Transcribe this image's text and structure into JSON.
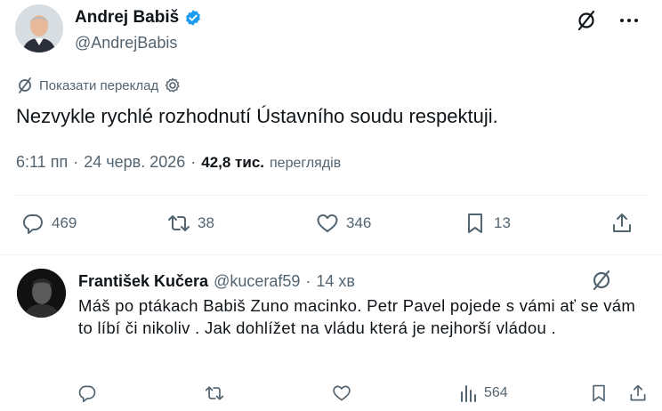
{
  "post": {
    "author_name": "Andrej Babiš",
    "author_handle": "@AndrejBabis",
    "translate_label": "Показати переклад",
    "text": "Nezvykle rychlé rozhodnutí Ústavního soudu respektuji.",
    "time": "6:11 пп",
    "date": "24 черв. 2026",
    "sep": "·",
    "views_count": "42,8 тис.",
    "views_label": "переглядів",
    "stats": {
      "replies": "469",
      "reposts": "38",
      "likes": "346",
      "bookmarks": "13"
    }
  },
  "reply": {
    "author_name": "František Kučera",
    "author_handle": "@kuceraf59",
    "sep": "·",
    "time": "14 хв",
    "text": "Máš po ptákach Babiš Zuno macinko. Petr Pavel pojede s vámi ať se vám to líbí či nikoliv . Jak dohlížet na vládu která je nejhorší vládou .",
    "views": "564"
  },
  "colors": {
    "text": "#0f1419",
    "secondary": "#536471",
    "verified": "#1d9bf0",
    "divider": "#eff3f4"
  },
  "icons": [
    "verified-badge-icon",
    "no-translate-icon",
    "more-icon",
    "gear-icon",
    "reply-icon",
    "repost-icon",
    "like-icon",
    "bookmark-icon",
    "share-icon",
    "views-icon"
  ]
}
